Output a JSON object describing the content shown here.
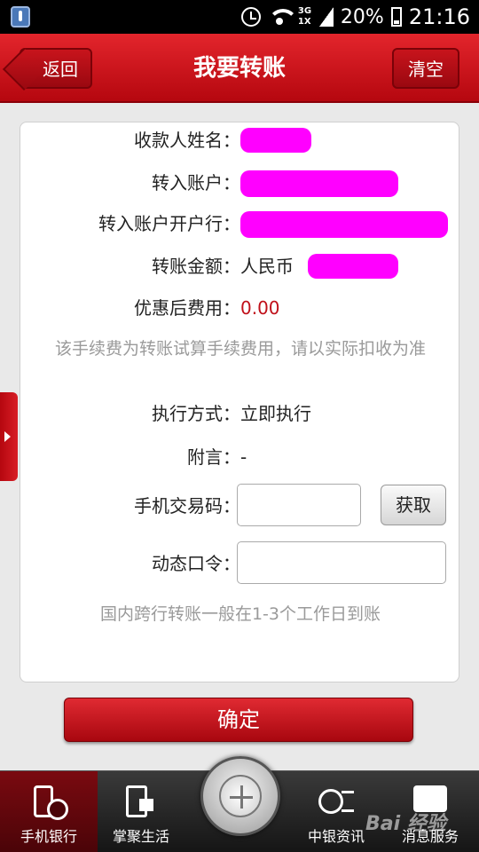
{
  "status_bar": {
    "network_top": "3G",
    "network_bottom": "1X",
    "battery": "20%",
    "time": "21:16"
  },
  "header": {
    "title": "我要转账",
    "back_label": "返回",
    "clear_label": "清空"
  },
  "form": {
    "payee_name_label": "收款人姓名：",
    "account_label": "转入账户：",
    "bank_label": "转入账户开户行：",
    "amount_label": "转账金额：",
    "currency": "人民币",
    "fee_label": "优惠后费用：",
    "fee_value": "0.00",
    "fee_note": "该手续费为转账试算手续费用，请以实际扣收为准",
    "exec_label": "执行方式：",
    "exec_value": "立即执行",
    "remark_label": "附言：",
    "remark_value": "-",
    "sms_code_label": "手机交易码：",
    "get_code_label": "获取",
    "token_label": "动态口令：",
    "arrival_note": "国内跨行转账一般在1-3个工作日到账"
  },
  "confirm_label": "确定",
  "bottom_nav": {
    "items": [
      {
        "label": "手机银行",
        "icon": "phone-bank-icon"
      },
      {
        "label": "掌聚生活",
        "icon": "life-icon"
      },
      {
        "label": "中银资讯",
        "icon": "boc-news-icon"
      },
      {
        "label": "消息服务",
        "icon": "message-icon"
      }
    ]
  },
  "watermark": "Bai 经验",
  "colors": {
    "brand_red": "#c8141c",
    "fee_red": "#c0101a",
    "redaction": "#ff00ff"
  }
}
